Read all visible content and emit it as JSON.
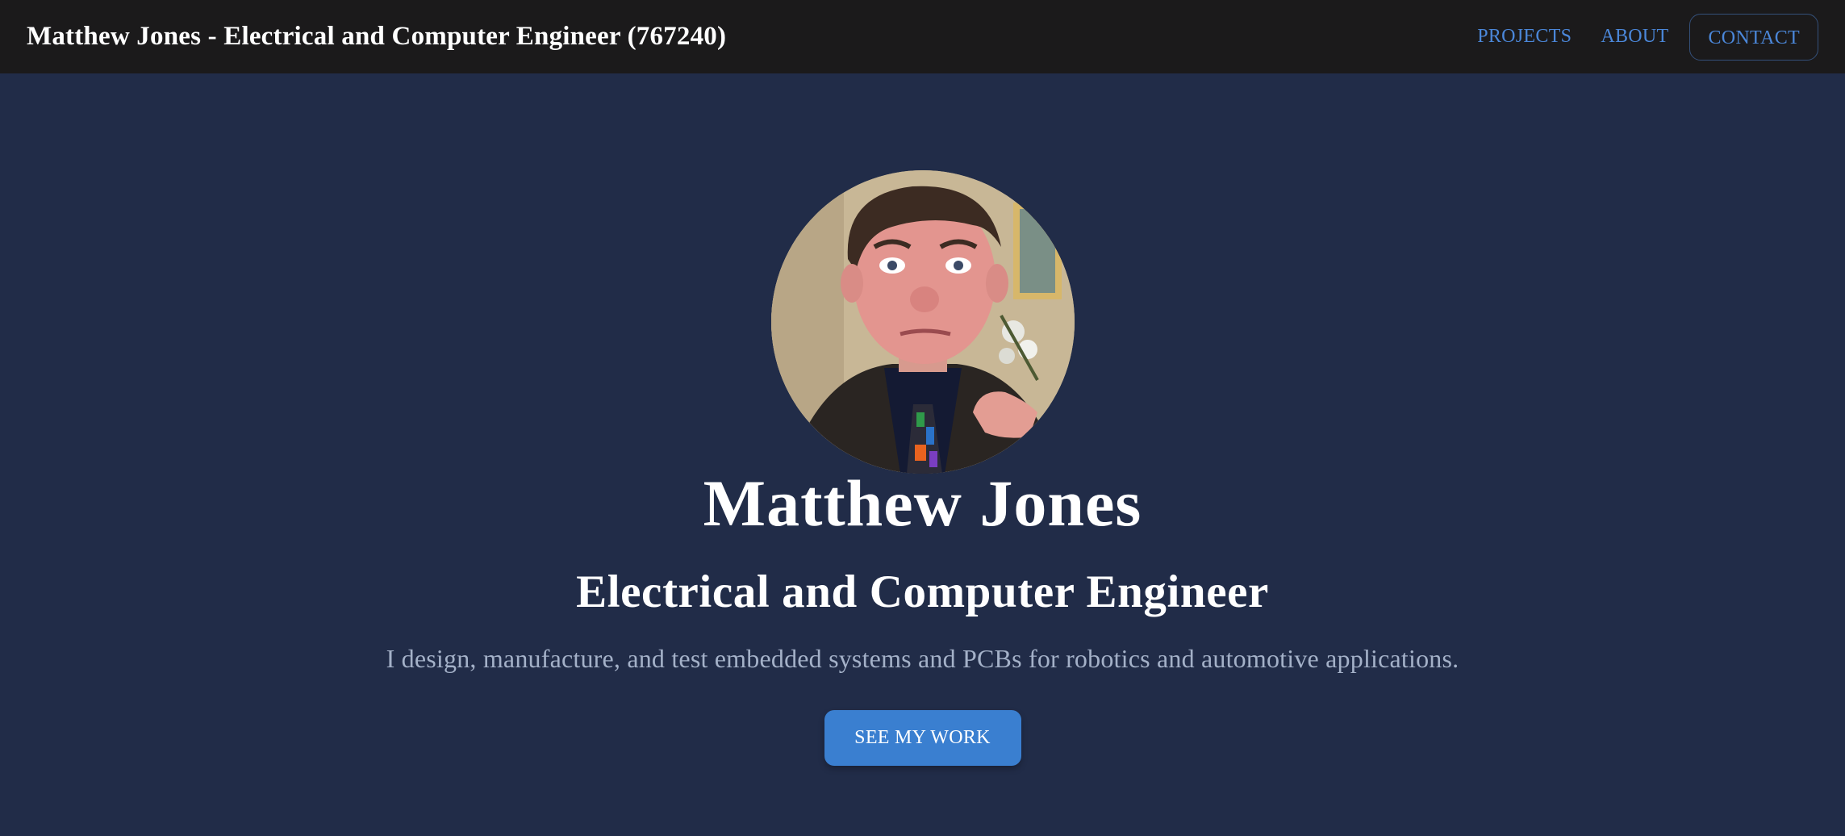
{
  "header": {
    "site_title": "Matthew Jones - Electrical and Computer Engineer (767240)",
    "nav": {
      "projects_label": "PROJECTS",
      "about_label": "ABOUT",
      "contact_label": "CONTACT"
    }
  },
  "hero": {
    "name": "Matthew Jones",
    "role": "Electrical and Computer Engineer",
    "tagline": "I design, manufacture, and test embedded systems and PCBs for robotics and automotive applications.",
    "cta_label": "SEE MY WORK"
  },
  "colors": {
    "header_bg": "#1b1a1b",
    "page_bg": "#212c48",
    "accent": "#3a7fd0",
    "nav_link": "#4b87d9",
    "tagline": "#a4b1c8"
  }
}
